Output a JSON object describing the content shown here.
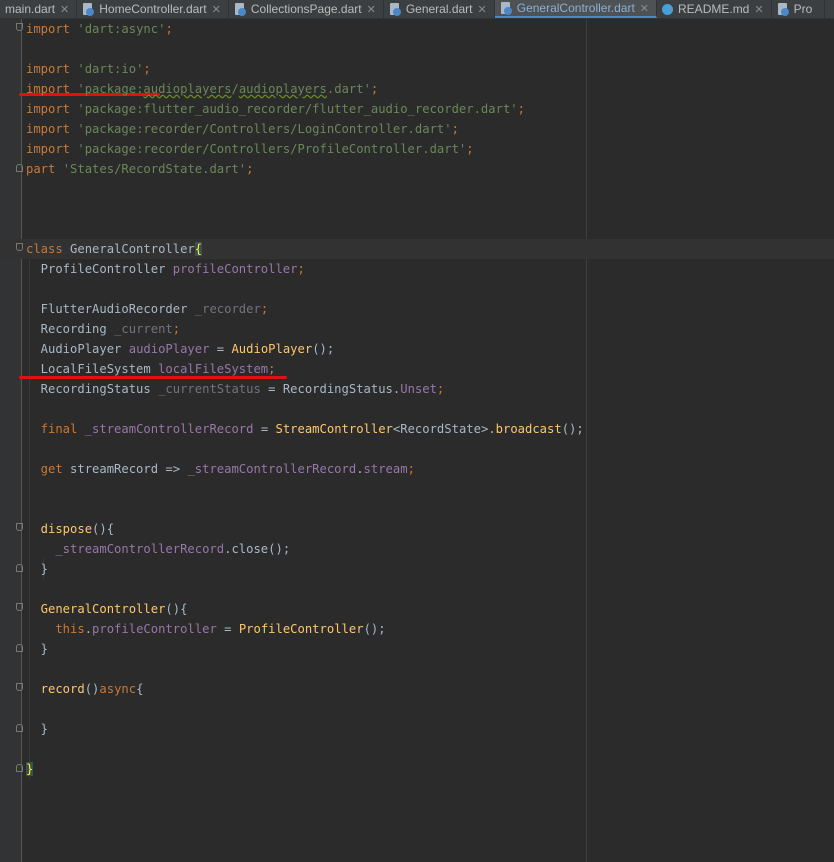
{
  "tabs": [
    {
      "label": "main.dart",
      "icon": "none",
      "active": false
    },
    {
      "label": "HomeController.dart",
      "icon": "dart-file-icon",
      "active": false
    },
    {
      "label": "CollectionsPage.dart",
      "icon": "dart-file-icon",
      "active": false
    },
    {
      "label": "General.dart",
      "icon": "dart-file-icon",
      "active": false
    },
    {
      "label": "GeneralController.dart",
      "icon": "dart-file-icon",
      "active": true
    },
    {
      "label": "README.md",
      "icon": "markdown-file-icon",
      "active": false
    },
    {
      "label": "Pro",
      "icon": "dart-file-icon",
      "active": false
    }
  ],
  "close_glyph": "✕",
  "code": {
    "l1": {
      "kw": "import",
      "sp": " ",
      "str": "'dart:async'",
      "end": ";"
    },
    "l3": {
      "kw": "import",
      "sp": " ",
      "str": "'dart:io'",
      "end": ";"
    },
    "l4": {
      "kw": "import",
      "sp": " ",
      "s1": "'package:",
      "s2": "audioplayers",
      "s3": "/",
      "s4": "audioplayers",
      "s5": ".dart'",
      "end": ";"
    },
    "l5": {
      "kw": "import",
      "sp": " ",
      "str": "'package:flutter_audio_recorder/flutter_audio_recorder.dart'",
      "end": ";"
    },
    "l6": {
      "kw": "import",
      "sp": " ",
      "str": "'package:recorder/Controllers/LoginController.dart'",
      "end": ";"
    },
    "l7": {
      "kw": "import",
      "sp": " ",
      "str": "'package:recorder/Controllers/ProfileController.dart'",
      "end": ";"
    },
    "l8": {
      "kw": "part",
      "sp": " ",
      "str": "'States/RecordState.dart'",
      "end": ";"
    },
    "l12": {
      "kw": "class",
      "name": " GeneralController",
      "brace": "{"
    },
    "l13": {
      "type": "  ProfileController ",
      "field": "profileController",
      "end": ";"
    },
    "l15": {
      "type": "  FlutterAudioRecorder ",
      "field": "_recorder",
      "end": ";"
    },
    "l16": {
      "type": "  Recording ",
      "field": "_current",
      "end": ";"
    },
    "l17": {
      "type": "  AudioPlayer ",
      "field": "audioPlayer",
      "mid": " = ",
      "call": "AudioPlayer",
      "end": "();"
    },
    "l18": {
      "type": "  LocalFileSystem ",
      "field": "localFileSystem",
      "end": ";"
    },
    "l19": {
      "type": "  RecordingStatus ",
      "field": "_currentStatus",
      "mid": " = RecordingStatus.",
      "const": "Unset",
      "end": ";"
    },
    "l21": {
      "kw": "  final",
      "field": " _streamControllerRecord",
      "mid": " = ",
      "call": "StreamController",
      "gen": "<RecordState>.",
      "call2": "broadcast",
      "end": "();"
    },
    "l23": {
      "kw": "  get",
      "name": " streamRecord => ",
      "field": "_streamControllerRecord",
      "dot": ".",
      "field2": "stream",
      "end": ";"
    },
    "l26": {
      "call": "  dispose",
      "end": "(){"
    },
    "l27": {
      "field": "    _streamControllerRecord",
      "mid": ".close();"
    },
    "l28": {
      "text": "  }"
    },
    "l30": {
      "call": "  GeneralController",
      "end": "(){"
    },
    "l31": {
      "kw": "    this",
      "dot": ".",
      "field": "profileController",
      "mid": " = ",
      "call": "ProfileController",
      "end": "();"
    },
    "l32": {
      "text": "  }"
    },
    "l34": {
      "call": "  record",
      "end": "()",
      "kw": "async",
      "brace": "{"
    },
    "l36": {
      "text": "  }"
    },
    "l38": {
      "brace": "}"
    }
  }
}
